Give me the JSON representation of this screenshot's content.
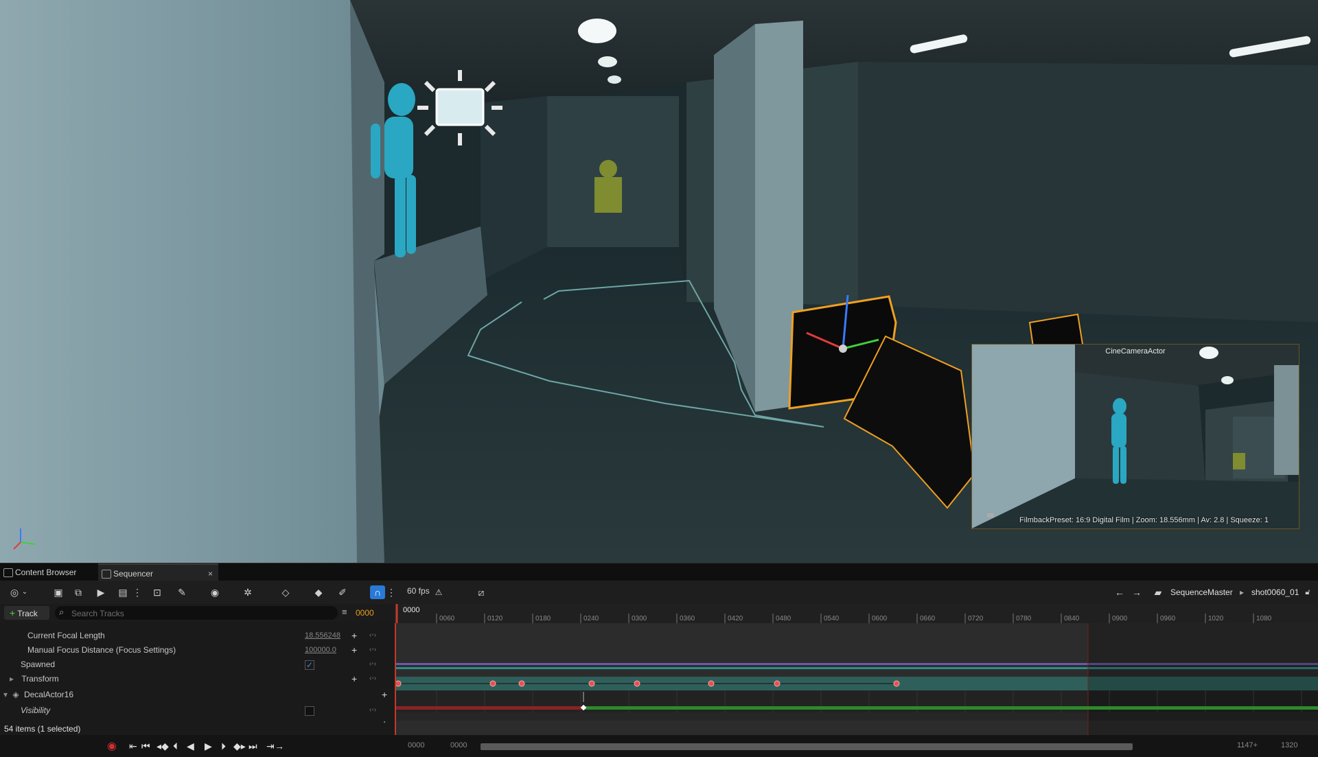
{
  "viewport": {
    "pip": {
      "title": "CineCameraActor",
      "info": "FilmbackPreset: 16:9 Digital Film | Zoom: 18.556mm | Av: 2.8 | Squeeze: 1"
    }
  },
  "tabs": [
    {
      "label": "Content Browser",
      "icon": "folder-icon"
    },
    {
      "label": "Sequencer",
      "icon": "clapper-icon"
    }
  ],
  "tab_close": "×",
  "toolbar": {
    "fps": "60 fps",
    "breadcrumb_parent": "SequenceMaster",
    "breadcrumb_current": "shot0060_01",
    "accent": "#2979d6"
  },
  "track_panel": {
    "add_track_label": "Track",
    "search_placeholder": "Search Tracks",
    "current_frame": "0000",
    "rows": [
      {
        "label": "Current Focal Length",
        "value": "18.556248"
      },
      {
        "label": "Manual Focus Distance (Focus Settings)",
        "value": "100000.0"
      },
      {
        "label": "Spawned"
      },
      {
        "label": "Transform"
      },
      {
        "label": "DecalActor16"
      },
      {
        "label": "Visibility"
      }
    ],
    "status": "54 items (1 selected)"
  },
  "timeline": {
    "start_label": "0000",
    "ticks": [
      "0060",
      "0120",
      "0180",
      "0240",
      "0300",
      "0360",
      "0420",
      "0480",
      "0540",
      "0600",
      "0660",
      "0720",
      "0780",
      "0840",
      "0900",
      "0960",
      "1020",
      "1080"
    ],
    "transform_keys": [
      0,
      115,
      150,
      235,
      290,
      380,
      460,
      605
    ],
    "visibility_key": 225,
    "colors": {
      "transform_lane": "#2f5f5a",
      "visibility_off": "#8a2323",
      "visibility_on": "#2c8a2c",
      "playhead": "#c43a2a"
    }
  },
  "transport": {
    "view_start": "0000",
    "play_start": "0000",
    "play_end": "1147+",
    "view_end": "1320"
  }
}
